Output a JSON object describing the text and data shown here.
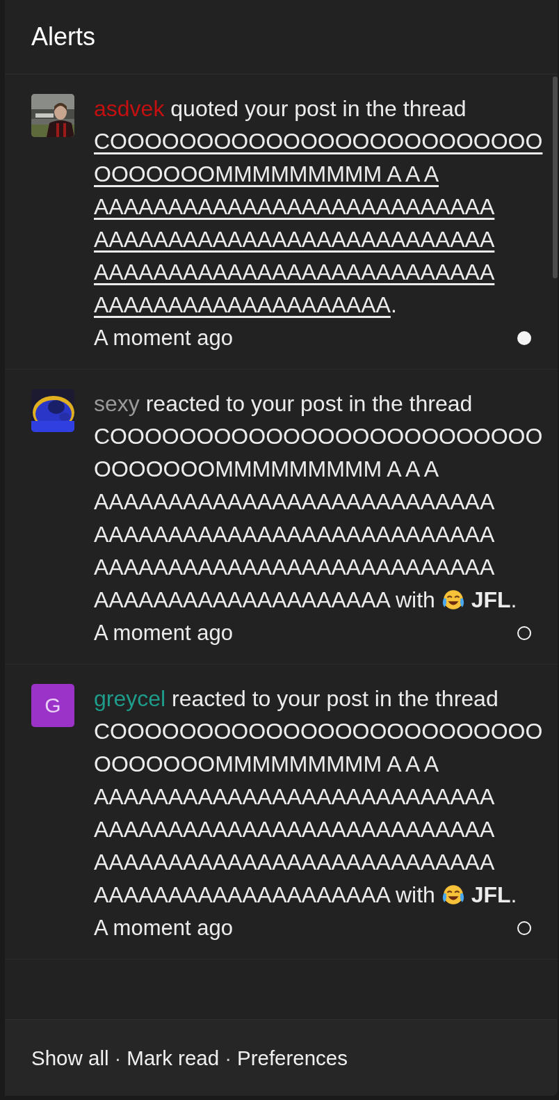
{
  "panel": {
    "title": "Alerts"
  },
  "alerts": [
    {
      "kind": "quote",
      "user": "asdvek",
      "color": "#c41010",
      "action": "quoted your post in the thread",
      "thread_lines": [
        "COOOOOOOOOOOOOOOOOOOOOOOOO",
        "OOOOOOOMMMMMMMMM A A A",
        "AAAAAAAAAAAAAAAAAAAAAAAAAAA",
        "AAAAAAAAAAAAAAAAAAAAAAAAAAA",
        "AAAAAAAAAAAAAAAAAAAAAAAAAAA",
        "AAAAAAAAAAAAAAAAAAAA"
      ],
      "thread_hovered": true,
      "end": ".",
      "time": "A moment ago",
      "read": false
    },
    {
      "kind": "reaction",
      "user": "sexy",
      "color": "#9a9a9a",
      "action": "reacted to your post in the thread",
      "thread_lines": [
        "COOOOOOOOOOOOOOOOOOOOOOOOO",
        "OOOOOOOMMMMMMMMM A A A",
        "AAAAAAAAAAAAAAAAAAAAAAAAAAA",
        "AAAAAAAAAAAAAAAAAAAAAAAAAAA",
        "AAAAAAAAAAAAAAAAAAAAAAAAAAA",
        "AAAAAAAAAAAAAAAAAAAA"
      ],
      "thread_hovered": false,
      "with": "with",
      "reaction": "JFL",
      "end": ".",
      "time": "A moment ago",
      "read": true
    },
    {
      "kind": "reaction",
      "avatar": {
        "kind": "letter",
        "letter": "G",
        "color": "#9b33c9"
      },
      "user": "greycel",
      "color": "#1e9c8c",
      "action": "reacted to your post in the thread",
      "thread_lines": [
        "COOOOOOOOOOOOOOOOOOOOOOOOO",
        "OOOOOOOMMMMMMMMM A A A",
        "AAAAAAAAAAAAAAAAAAAAAAAAAAA",
        "AAAAAAAAAAAAAAAAAAAAAAAAAAA",
        "AAAAAAAAAAAAAAAAAAAAAAAAAAA",
        "AAAAAAAAAAAAAAAAAAAA"
      ],
      "thread_hovered": false,
      "with": "with",
      "reaction": "JFL",
      "end": ".",
      "time": "A moment ago",
      "read": true
    }
  ],
  "footer": {
    "links": [
      "Show all",
      "Mark read",
      "Preferences"
    ],
    "separator": "·"
  }
}
